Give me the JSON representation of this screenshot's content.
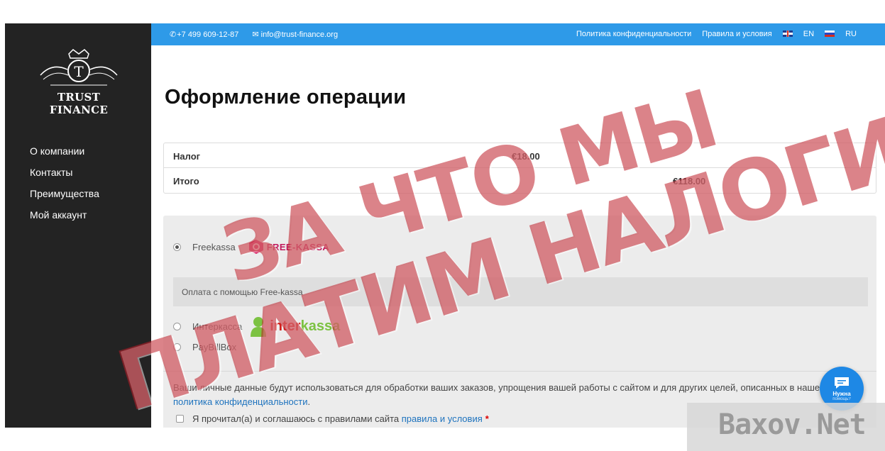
{
  "topbar": {
    "phone": "+7 499 609-12-87",
    "email": "info@trust-finance.org",
    "privacy_link": "Политика конфиденциальности",
    "terms_link": "Правила и условия",
    "lang_en": "EN",
    "lang_ru": "RU"
  },
  "sidebar": {
    "logo_text": "TRUST FINANCE",
    "items": [
      {
        "label": "О компании"
      },
      {
        "label": "Контакты"
      },
      {
        "label": "Преимущества"
      },
      {
        "label": "Мой аккаунт"
      }
    ]
  },
  "main": {
    "title": "Оформление операции",
    "totals": [
      {
        "label": "Налог",
        "value": "€18.00"
      },
      {
        "label": "Итого",
        "value": "€118.00"
      }
    ],
    "payment_options": [
      {
        "label": "Freekassa",
        "logo": "FREE-KASSA",
        "checked": true
      },
      {
        "label": "Интеркасса",
        "logo_a": "inter",
        "logo_b": "kassa",
        "checked": false
      },
      {
        "label": "PayBillBox",
        "checked": false
      }
    ],
    "payment_description": "Оплата с помощью Free-kassa",
    "privacy_text": "Ваши личные данные будут использоваться для обработки ваших заказов, упрощения вашей работы с сайтом и для других целей, описанных в нашей",
    "privacy_link": "политика конфиденциальности",
    "privacy_end": ".",
    "terms_text": "Я прочитал(а) и соглашаюсь с правилами сайта",
    "terms_link": "правила и условия",
    "terms_required": "*"
  },
  "chat": {
    "label": "Нужна",
    "sub": "помощь?"
  },
  "watermark": {
    "line1": "ЗА ЧТО МЫ",
    "line2": "ПЛАТИМ НАЛОГИ?",
    "brand": "Baxov.Net"
  },
  "colors": {
    "topbar": "#2e9ae8",
    "sidebar": "#232323",
    "link": "#1e73be",
    "stamp": "#be1e28"
  }
}
